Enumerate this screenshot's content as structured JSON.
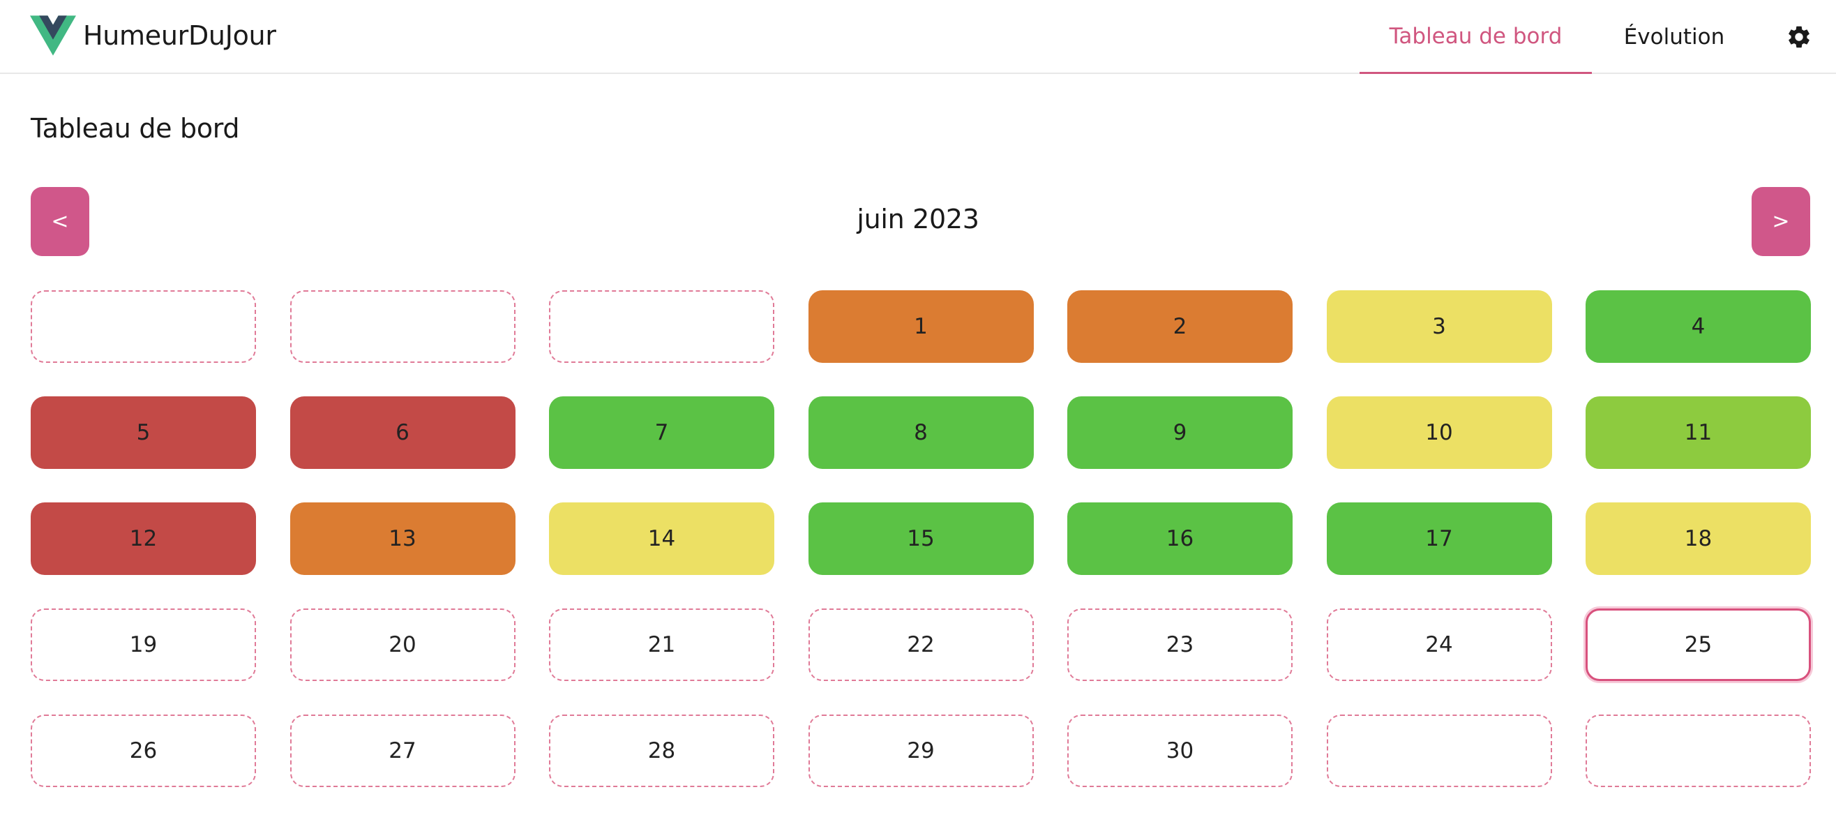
{
  "app": {
    "name": "HumeurDuJour"
  },
  "nav": {
    "tabs": [
      {
        "label": "Tableau de bord",
        "active": true
      },
      {
        "label": "Évolution",
        "active": false
      }
    ],
    "settings_icon": "gear-icon",
    "accent_color": "#d0567f"
  },
  "page": {
    "title": "Tableau de bord"
  },
  "calendar": {
    "month_label": "juin 2023",
    "prev_label": "<",
    "next_label": ">",
    "mood_colors": {
      "1": "#c34a47",
      "2": "#db7c32",
      "3": "#ece064",
      "4": "#8dcb3f",
      "5": "#5bc245"
    },
    "cells": [
      {
        "day": "",
        "mood": null
      },
      {
        "day": "",
        "mood": null
      },
      {
        "day": "",
        "mood": null
      },
      {
        "day": "1",
        "mood": 2
      },
      {
        "day": "2",
        "mood": 2
      },
      {
        "day": "3",
        "mood": 3
      },
      {
        "day": "4",
        "mood": 5
      },
      {
        "day": "5",
        "mood": 1
      },
      {
        "day": "6",
        "mood": 1
      },
      {
        "day": "7",
        "mood": 5
      },
      {
        "day": "8",
        "mood": 5
      },
      {
        "day": "9",
        "mood": 5
      },
      {
        "day": "10",
        "mood": 3
      },
      {
        "day": "11",
        "mood": 4
      },
      {
        "day": "12",
        "mood": 1
      },
      {
        "day": "13",
        "mood": 2
      },
      {
        "day": "14",
        "mood": 3
      },
      {
        "day": "15",
        "mood": 5
      },
      {
        "day": "16",
        "mood": 5
      },
      {
        "day": "17",
        "mood": 5
      },
      {
        "day": "18",
        "mood": 3
      },
      {
        "day": "19",
        "mood": null
      },
      {
        "day": "20",
        "mood": null
      },
      {
        "day": "21",
        "mood": null
      },
      {
        "day": "22",
        "mood": null
      },
      {
        "day": "23",
        "mood": null
      },
      {
        "day": "24",
        "mood": null
      },
      {
        "day": "25",
        "mood": null,
        "today": true
      },
      {
        "day": "26",
        "mood": null
      },
      {
        "day": "27",
        "mood": null
      },
      {
        "day": "28",
        "mood": null
      },
      {
        "day": "29",
        "mood": null
      },
      {
        "day": "30",
        "mood": null
      },
      {
        "day": "",
        "mood": null
      },
      {
        "day": "",
        "mood": null
      }
    ]
  }
}
